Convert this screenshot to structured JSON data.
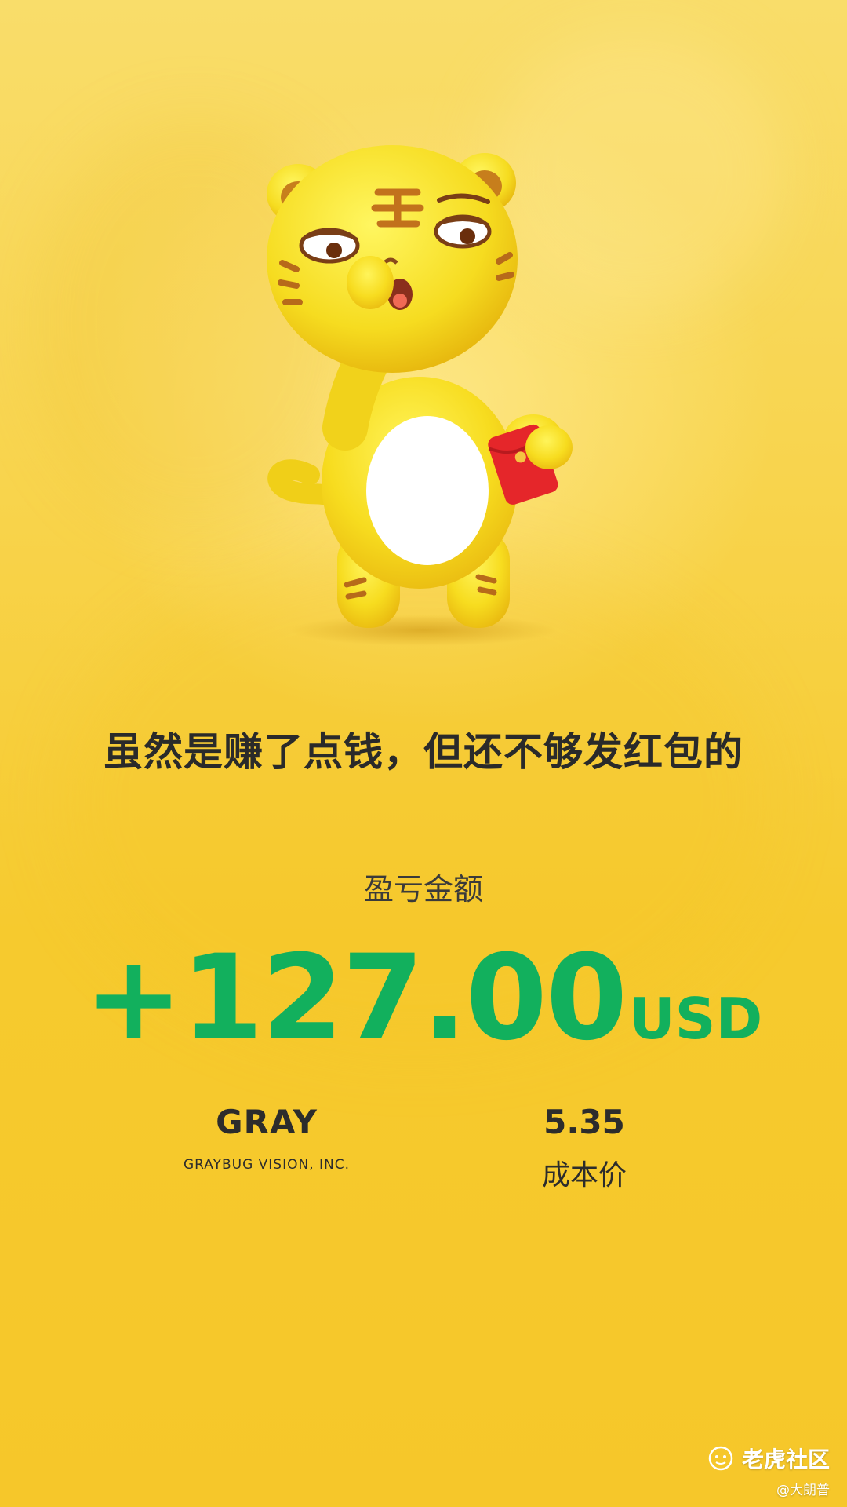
{
  "headline": "虽然是赚了点钱，但还不够发红包的",
  "pnl": {
    "label": "盈亏金额",
    "amount": "+127.00",
    "currency": "USD"
  },
  "stock": {
    "ticker": "GRAY",
    "company": "GRAYBUG VISION, INC."
  },
  "cost": {
    "value": "5.35",
    "label": "成本价"
  },
  "watermark": {
    "brand": "老虎社区",
    "user": "@大朗普"
  },
  "colors": {
    "background": "#f7cc33",
    "profit_green": "#12b05d",
    "text_dark": "#2c2c2c"
  },
  "icons": {
    "mascot": "tiger-mascot-with-red-envelope",
    "watermark": "tiger-logo-icon"
  }
}
